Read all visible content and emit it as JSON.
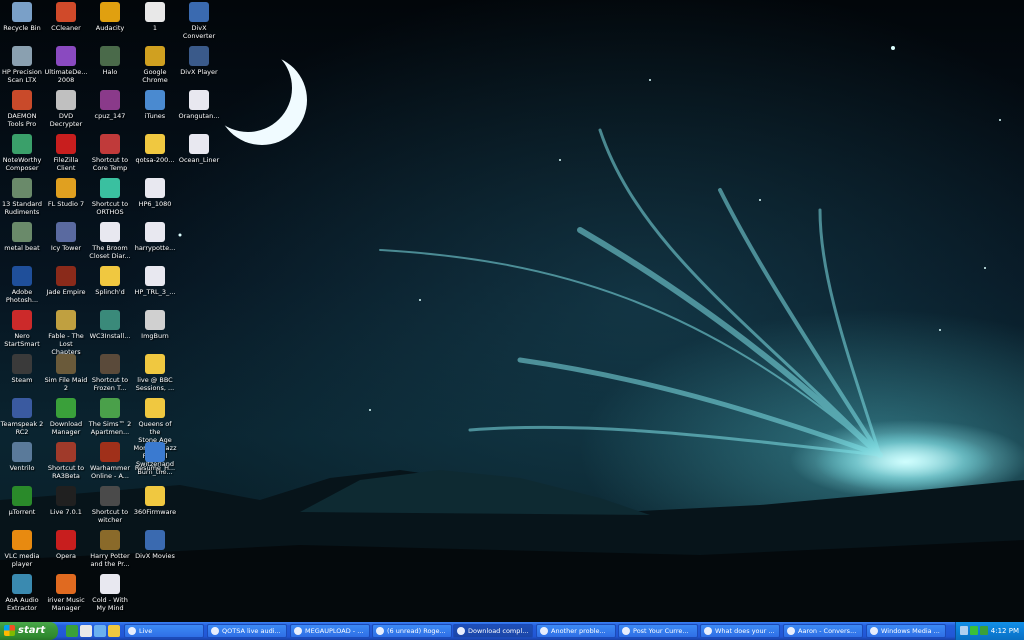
{
  "desktop": {
    "icons": [
      {
        "label": "Recycle Bin",
        "icon": "recycle-bin-icon",
        "color": "#7aa0c8"
      },
      {
        "label": "HP Precision\nScan LTX",
        "icon": "scanner-icon",
        "color": "#8aa0b0"
      },
      {
        "label": "DAEMON\nTools Pro",
        "icon": "daemon-tools-icon",
        "color": "#c94a2a"
      },
      {
        "label": "NoteWorthy\nComposer",
        "icon": "music-score-icon",
        "color": "#3aa06a"
      },
      {
        "label": "13 Standard\nRudiments",
        "icon": "document-icon",
        "color": "#6a8a6a"
      },
      {
        "label": "metal beat",
        "icon": "document-icon",
        "color": "#6a8a6a"
      },
      {
        "label": "Adobe\nPhotosh...",
        "icon": "photoshop-icon",
        "color": "#1f4f9a"
      },
      {
        "label": "Nero\nStartSmart",
        "icon": "nero-icon",
        "color": "#cc2a2a"
      },
      {
        "label": "Steam",
        "icon": "steam-icon",
        "color": "#3a3a3a"
      },
      {
        "label": "Teamspeak 2\nRC2",
        "icon": "teamspeak-icon",
        "color": "#3a5aa0"
      },
      {
        "label": "Ventrilo",
        "icon": "ventrilo-icon",
        "color": "#5a7a9a"
      },
      {
        "label": "µTorrent",
        "icon": "utorrent-icon",
        "color": "#2a8a2a"
      },
      {
        "label": "VLC media\nplayer",
        "icon": "vlc-icon",
        "color": "#e88a10"
      },
      {
        "label": "AoA Audio\nExtractor",
        "icon": "audio-extractor-icon",
        "color": "#3a8ab0"
      },
      {
        "label": "CCleaner",
        "icon": "ccleaner-icon",
        "color": "#d04a2a"
      },
      {
        "label": "UltimateDe...\n2008",
        "icon": "globe-icon",
        "color": "#8a4ac0"
      },
      {
        "label": "DVD\nDecrypter",
        "icon": "dvd-icon",
        "color": "#c0c0c0"
      },
      {
        "label": "FileZilla Client",
        "icon": "filezilla-icon",
        "color": "#c81e1e"
      },
      {
        "label": "FL Studio 7",
        "icon": "fl-studio-icon",
        "color": "#e0a020"
      },
      {
        "label": "Icy Tower",
        "icon": "icy-tower-icon",
        "color": "#5a6aa0"
      },
      {
        "label": "Jade Empire",
        "icon": "jade-empire-icon",
        "color": "#8a2a1a"
      },
      {
        "label": "Fable - The\nLost Chapters",
        "icon": "fable-icon",
        "color": "#c0a040"
      },
      {
        "label": "Sim File Maid 2",
        "icon": "sims-icon",
        "color": "#6a5a3a"
      },
      {
        "label": "Download\nManager",
        "icon": "download-icon",
        "color": "#3aa03a"
      },
      {
        "label": "Shortcut to\nRA3Beta",
        "icon": "game-icon",
        "color": "#a03a2a"
      },
      {
        "label": "Live 7.0.1",
        "icon": "ableton-icon",
        "color": "#202020"
      },
      {
        "label": "Opera",
        "icon": "opera-icon",
        "color": "#c81e1e"
      },
      {
        "label": "iriver Music\nManager",
        "icon": "music-manager-icon",
        "color": "#e06a20"
      },
      {
        "label": "Audacity",
        "icon": "audacity-icon",
        "color": "#e0a010"
      },
      {
        "label": "Halo",
        "icon": "halo-icon",
        "color": "#4a6a4a"
      },
      {
        "label": "cpuz_147",
        "icon": "winrar-icon",
        "color": "#8a3a8a"
      },
      {
        "label": "Shortcut to\nCore Temp",
        "icon": "thermometer-icon",
        "color": "#c03a3a"
      },
      {
        "label": "Shortcut to\nORTHOS",
        "icon": "orthos-icon",
        "color": "#3ac0a0"
      },
      {
        "label": "The Broom\nCloset Diar...",
        "icon": "audio-file-icon",
        "color": "#e8e8f0"
      },
      {
        "label": "Splinch'd",
        "icon": "folder-icon",
        "color": "#f0c840"
      },
      {
        "label": "WC3Install...",
        "icon": "installer-icon",
        "color": "#3a8a7a"
      },
      {
        "label": "Shortcut to\nFrozen T...",
        "icon": "game-icon",
        "color": "#5a4a3a"
      },
      {
        "label": "The Sims™ 2\nApartmen...",
        "icon": "sims-icon",
        "color": "#4aa04a"
      },
      {
        "label": "Warhammer\nOnline - A...",
        "icon": "warhammer-icon",
        "color": "#a0301a"
      },
      {
        "label": "Shortcut to\nwitcher",
        "icon": "witcher-icon",
        "color": "#4a4a4a"
      },
      {
        "label": "Harry Potter\nand the Pr...",
        "icon": "game-icon",
        "color": "#8a6a2a"
      },
      {
        "label": "Cold - With\nMy Mind",
        "icon": "audio-file-icon",
        "color": "#e8e8f0"
      },
      {
        "label": "1",
        "icon": "text-file-icon",
        "color": "#e8e8e8"
      },
      {
        "label": "Google\nChrome",
        "icon": "chrome-icon",
        "color": "#d0a020"
      },
      {
        "label": "iTunes",
        "icon": "itunes-icon",
        "color": "#4a8ad0"
      },
      {
        "label": "qotsa-200...",
        "icon": "folder-icon",
        "color": "#f0c840"
      },
      {
        "label": "HP6_1080",
        "icon": "video-file-icon",
        "color": "#e8e8f0"
      },
      {
        "label": "harrypotte...",
        "icon": "video-file-icon",
        "color": "#e8e8f0"
      },
      {
        "label": "HP_TRL_3_...",
        "icon": "video-file-icon",
        "color": "#e8e8f0"
      },
      {
        "label": "ImgBurn",
        "icon": "imgburn-icon",
        "color": "#d0d0d0"
      },
      {
        "label": "live @ BBC\nSessions, ...",
        "icon": "folder-icon",
        "color": "#f0c840"
      },
      {
        "label": "Queens of the\nStone Age\nMonreux Jazz\nFestival\nSwitzerland\nBurn_the...",
        "icon": "folder-icon",
        "color": "#f0c840"
      },
      {
        "label": "Resume_H...",
        "icon": "ie-document-icon",
        "color": "#3a7ad0"
      },
      {
        "label": "360Firmware",
        "icon": "folder-icon",
        "color": "#f0c840"
      },
      {
        "label": "DivX Movies",
        "icon": "divx-icon",
        "color": "#3a6ab0"
      },
      {
        "label": "DivX\nConverter",
        "icon": "divx-icon",
        "color": "#3a6ab0"
      },
      {
        "label": "DivX Player",
        "icon": "divx-icon",
        "color": "#3a5a8a"
      },
      {
        "label": "Orangutan...",
        "icon": "audio-file-icon",
        "color": "#e8e8f0"
      },
      {
        "label": "Ocean_Liner",
        "icon": "audio-file-icon",
        "color": "#e8e8f0"
      }
    ]
  },
  "taskbar": {
    "start_label": "start",
    "quick_launch": [
      {
        "icon": "desktop-icon",
        "color": "#3aa03a"
      },
      {
        "icon": "media-icon",
        "color": "#e8e8e8"
      },
      {
        "icon": "ie-icon",
        "color": "#6ab0f0"
      },
      {
        "icon": "folder-icon",
        "color": "#f0c840"
      }
    ],
    "tasks": [
      {
        "label": "Live",
        "icon": "folder-icon"
      },
      {
        "label": "QOTSA live audi...",
        "icon": "ie-icon"
      },
      {
        "label": "MEGAUPLOAD - ...",
        "icon": "ie-icon"
      },
      {
        "label": "(6 unread) Roge...",
        "icon": "ie-icon"
      },
      {
        "label": "Download compl...",
        "icon": "ie-icon"
      },
      {
        "label": "Another proble...",
        "icon": "ie-icon"
      },
      {
        "label": "Post Your Curre...",
        "icon": "ie-icon"
      },
      {
        "label": "What does your ...",
        "icon": "ie-icon"
      },
      {
        "label": "Aaron - Convers...",
        "icon": "messenger-icon"
      },
      {
        "label": "Windows Media ...",
        "icon": "media-player-icon"
      }
    ],
    "active_task": 4,
    "tray_icons": [
      {
        "icon": "network-icon",
        "color": "#b0d0f0"
      },
      {
        "icon": "messenger-icon",
        "color": "#3ac03a"
      },
      {
        "icon": "utorrent-icon",
        "color": "#3aa03a"
      }
    ],
    "clock": "4:12 PM"
  }
}
